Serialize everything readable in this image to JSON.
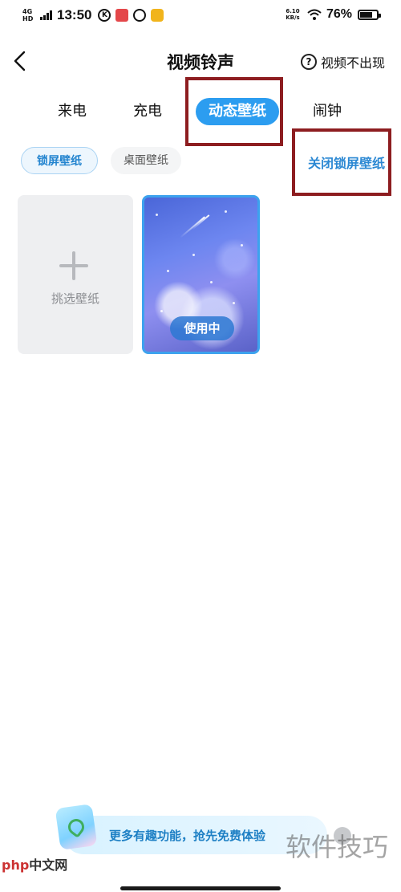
{
  "status_bar": {
    "network": "4G HD",
    "time": "13:50",
    "speed": "6.10 KB/s",
    "battery_percent": "76%",
    "battery_level": 0.76
  },
  "header": {
    "title": "视频铃声",
    "help_label": "视频不出现"
  },
  "tabs": [
    {
      "label": "来电"
    },
    {
      "label": "充电"
    },
    {
      "label": "动态壁纸",
      "active": true
    },
    {
      "label": "闹钟"
    }
  ],
  "subtabs": [
    {
      "label": "锁屏壁纸",
      "active": true
    },
    {
      "label": "桌面壁纸"
    }
  ],
  "close_lock_wallpaper": "关闭锁屏壁纸",
  "grid": {
    "pick_label": "挑选壁纸",
    "in_use_label": "使用中"
  },
  "promo": {
    "text": "更多有趣功能，抢先免费体验"
  },
  "watermarks": {
    "left_brand": "php",
    "left_site": "中文网",
    "right": "软件技巧"
  },
  "colors": {
    "accent": "#2c9df0",
    "annotation": "#8d1d20"
  }
}
